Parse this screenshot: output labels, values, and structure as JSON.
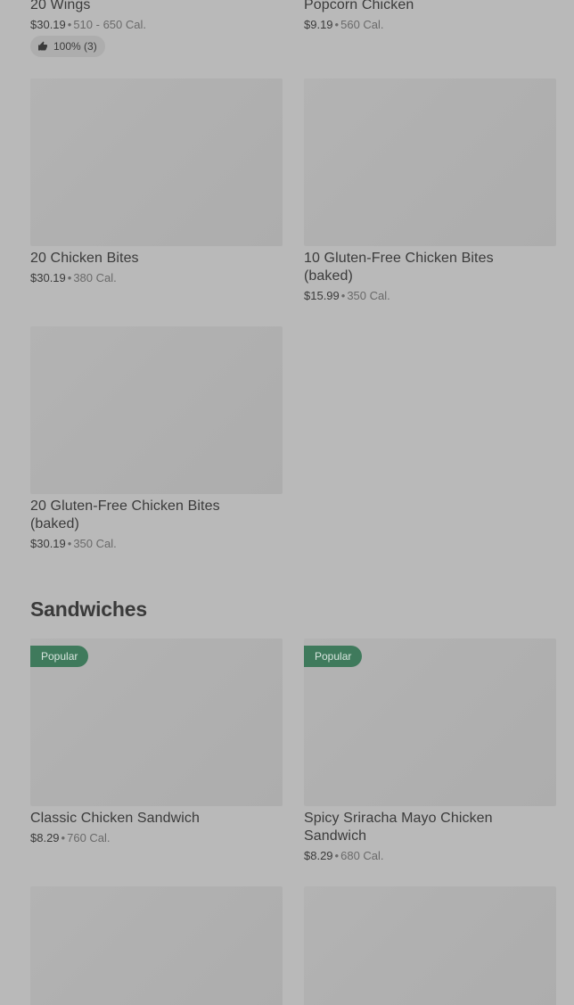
{
  "items": {
    "wings20": {
      "name": "20 Wings",
      "price": "$30.19",
      "calories": "510 - 650 Cal.",
      "rating": "100% (3)"
    },
    "popcorn": {
      "name": "Popcorn Chicken",
      "price": "$9.19",
      "calories": "560 Cal."
    },
    "bites20": {
      "name": "20 Chicken Bites",
      "price": "$30.19",
      "calories": "380 Cal."
    },
    "gf10": {
      "name": "10 Gluten-Free Chicken Bites (baked)",
      "price": "$15.99",
      "calories": "350 Cal."
    },
    "gf20": {
      "name": "20 Gluten-Free Chicken Bites (baked)",
      "price": "$30.19",
      "calories": "350 Cal."
    },
    "classic": {
      "name": "Classic Chicken Sandwich",
      "price": "$8.29",
      "calories": "760 Cal.",
      "badge": "Popular"
    },
    "spicy": {
      "name": "Spicy Sriracha Mayo Chicken Sandwich",
      "price": "$8.29",
      "calories": "680 Cal.",
      "badge": "Popular"
    }
  },
  "sections": {
    "sandwiches": {
      "title": "Sandwiches"
    }
  },
  "separator": "•",
  "colors": {
    "background": "#b9b9b9",
    "badge": "#3f7a5c",
    "placeholder": "#b1b1b1"
  }
}
